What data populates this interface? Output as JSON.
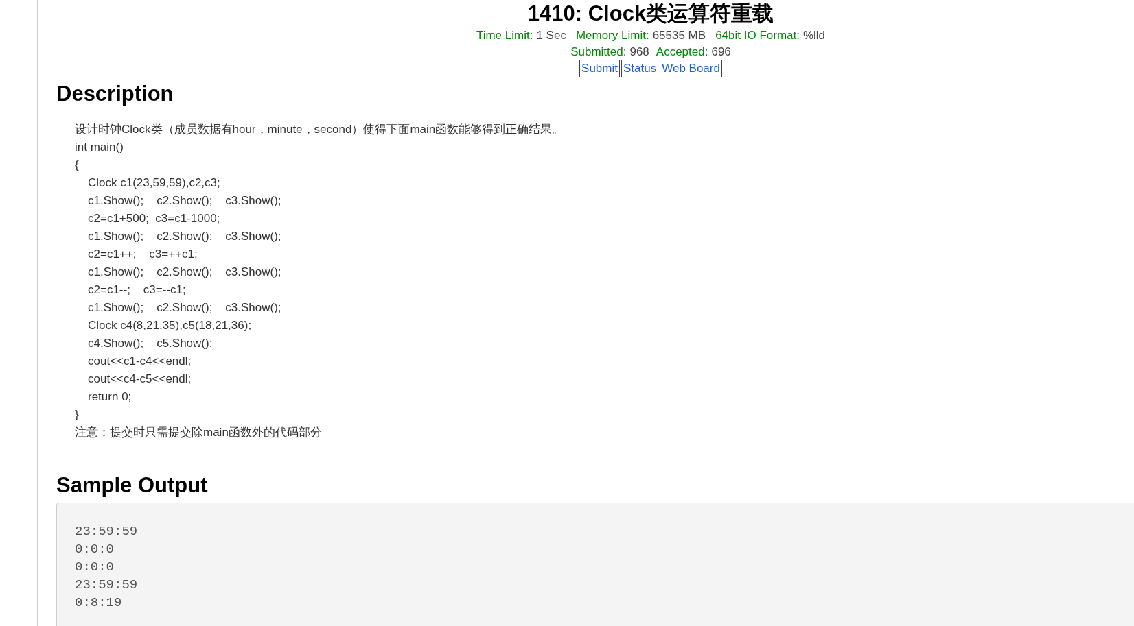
{
  "problem": {
    "title": "1410: Clock类运算符重载",
    "limits": [
      {
        "label": "Time Limit:",
        "value": "1 Sec"
      },
      {
        "label": "Memory Limit:",
        "value": "65535 MB"
      },
      {
        "label": "64bit IO Format:",
        "value": "%lld"
      }
    ],
    "stats": [
      {
        "label": "Submitted:",
        "value": "968"
      },
      {
        "label": "Accepted:",
        "value": "696"
      }
    ],
    "links": [
      "Submit",
      "Status",
      "Web Board"
    ]
  },
  "description": {
    "heading": "Description",
    "lines": [
      {
        "kind": "plain",
        "text": "设计时钟Clock类（成员数据有hour，minute，second）使得下面main函数能够得到正确结果。"
      },
      {
        "kind": "plain",
        "text": "int main()"
      },
      {
        "kind": "plain",
        "text": "{"
      },
      {
        "kind": "indented",
        "text": "Clock c1(23,59,59),c2,c3;"
      },
      {
        "kind": "indented",
        "text": "c1.Show();    c2.Show();    c3.Show();"
      },
      {
        "kind": "indented",
        "text": "c2=c1+500;  c3=c1-1000;"
      },
      {
        "kind": "indented",
        "text": "c1.Show();    c2.Show();    c3.Show();"
      },
      {
        "kind": "indented",
        "text": "c2=c1++;    c3=++c1;"
      },
      {
        "kind": "indented",
        "text": "c1.Show();    c2.Show();    c3.Show();"
      },
      {
        "kind": "indented",
        "text": "c2=c1--;    c3=--c1;"
      },
      {
        "kind": "indented",
        "text": "c1.Show();    c2.Show();    c3.Show();"
      },
      {
        "kind": "indented",
        "text": "Clock c4(8,21,35),c5(18,21,36);"
      },
      {
        "kind": "indented",
        "text": "c4.Show();    c5.Show();"
      },
      {
        "kind": "indented",
        "text": "cout<<c1-c4<<endl;"
      },
      {
        "kind": "indented",
        "text": "cout<<c4-c5<<endl;"
      },
      {
        "kind": "indented",
        "text": "return 0;"
      },
      {
        "kind": "plain",
        "text": "}"
      },
      {
        "kind": "plain",
        "text": "注意：提交时只需提交除main函数外的代码部分"
      }
    ]
  },
  "sample_output": {
    "heading": "Sample Output",
    "lines": [
      "23:59:59",
      "0:0:0",
      "0:0:0",
      "23:59:59",
      "0:8:19"
    ]
  }
}
